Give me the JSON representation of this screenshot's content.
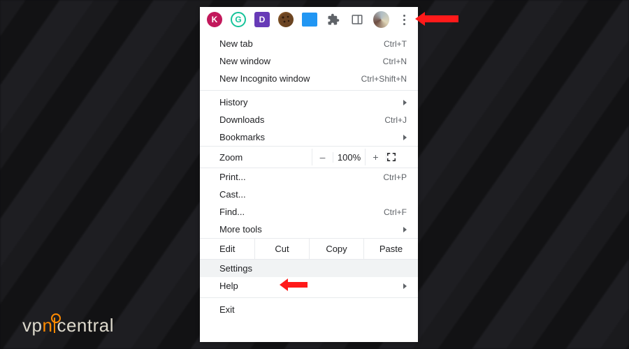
{
  "annotations": {
    "arrow_to": "three-dots-menu-button",
    "highlighted_item": "Settings"
  },
  "toolbar_icons": [
    "K",
    "G",
    "D",
    "cookie",
    "blue-square",
    "puzzle",
    "reader",
    "avatar",
    "three-dots"
  ],
  "menu": {
    "new_tab": {
      "label": "New tab",
      "shortcut": "Ctrl+T"
    },
    "new_window": {
      "label": "New window",
      "shortcut": "Ctrl+N"
    },
    "incognito": {
      "label": "New Incognito window",
      "shortcut": "Ctrl+Shift+N"
    },
    "history": {
      "label": "History"
    },
    "downloads": {
      "label": "Downloads",
      "shortcut": "Ctrl+J"
    },
    "bookmarks": {
      "label": "Bookmarks"
    },
    "zoom": {
      "label": "Zoom",
      "minus": "–",
      "value": "100%",
      "plus": "+"
    },
    "print": {
      "label": "Print...",
      "shortcut": "Ctrl+P"
    },
    "cast": {
      "label": "Cast..."
    },
    "find": {
      "label": "Find...",
      "shortcut": "Ctrl+F"
    },
    "more_tools": {
      "label": "More tools"
    },
    "edit": {
      "label": "Edit",
      "cut": "Cut",
      "copy": "Copy",
      "paste": "Paste"
    },
    "settings": {
      "label": "Settings"
    },
    "help": {
      "label": "Help"
    },
    "exit": {
      "label": "Exit"
    }
  },
  "watermark": {
    "left": "vp",
    "right": "central"
  }
}
